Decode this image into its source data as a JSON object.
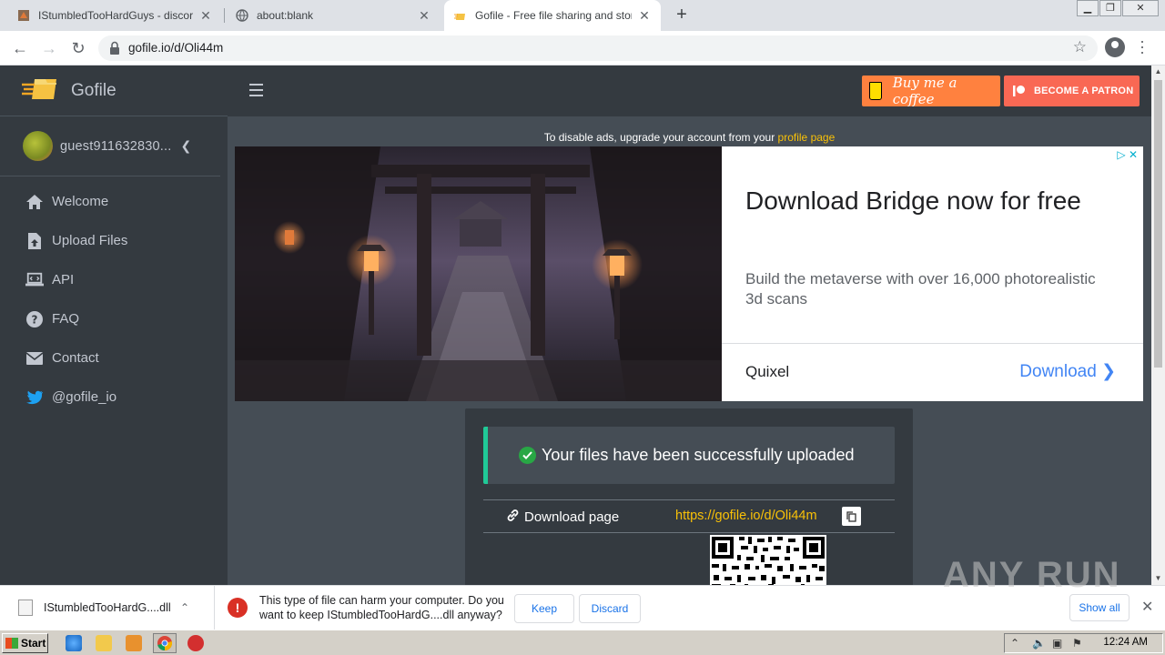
{
  "browser": {
    "tabs": [
      {
        "title": "IStumbledTooHardGuys - discord.gg/",
        "active": false
      },
      {
        "title": "about:blank",
        "active": false
      },
      {
        "title": "Gofile - Free file sharing and storage",
        "active": true
      }
    ],
    "new_tab_label": "+",
    "url": "gofile.io/d/Oli44m"
  },
  "sidebar": {
    "brand": "Gofile",
    "username": "guest911632830...",
    "items": [
      {
        "label": "Welcome",
        "icon": "home-icon"
      },
      {
        "label": "Upload Files",
        "icon": "file-upload-icon"
      },
      {
        "label": "API",
        "icon": "laptop-code-icon"
      },
      {
        "label": "FAQ",
        "icon": "question-circle-icon"
      },
      {
        "label": "Contact",
        "icon": "envelope-icon"
      },
      {
        "label": "@gofile_io",
        "icon": "twitter-icon"
      }
    ]
  },
  "header": {
    "coffee_label": "Buy me a coffee",
    "patron_label": "BECOME A PATRON"
  },
  "ad_notice": {
    "prefix": "To disable ads, upgrade your account from your",
    "link": "profile page"
  },
  "ad": {
    "headline": "Download Bridge now for free",
    "body": "Build the metaverse with over 16,000 photorealistic 3d scans",
    "advertiser": "Quixel",
    "cta": "Download"
  },
  "upload": {
    "success_message": "Your files have been successfully uploaded",
    "download_label": "Download page",
    "download_url": "https://gofile.io/d/Oli44m"
  },
  "download_bar": {
    "file_name": "IStumbledTooHardG....dll",
    "warning": "This type of file can harm your computer. Do you want to keep IStumbledTooHardG....dll anyway?",
    "keep_label": "Keep",
    "discard_label": "Discard",
    "show_all_label": "Show all",
    "watermark": "ANY RUN"
  },
  "taskbar": {
    "start_label": "Start",
    "clock": "12:24 AM"
  },
  "colors": {
    "sidebar_bg": "#343a40",
    "main_bg": "#454d55",
    "accent_yellow": "#f9c107",
    "success_green": "#28a745",
    "coffee_orange": "#ff813f",
    "patron_red": "#f96854"
  }
}
